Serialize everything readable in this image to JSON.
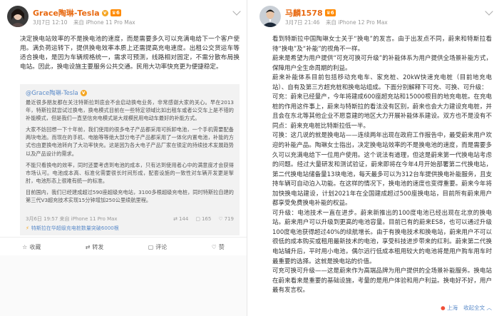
{
  "left": {
    "username": "Grace陶琳-Tesla",
    "level": "6",
    "date": "3月7日 12:10",
    "source": "来自 iPhone 11 Pro Max",
    "paragraphs": [
      "决定换电站效率的不是换电池的速度，而是需要多久可以充满电给下一个客户使用。满负荷运转下，提供换电效率本质上还需提高充电速度。出租公交货运车等适合换电，是因为车辆规格统一，需求可预测，线路相对固定，不需分散布局换电站。因此，换电设施主要服务公共交通。民用大功率快充更为便捷稳定。"
    ],
    "quote": {
      "author": "@Grace陶琳-Tesla",
      "paragraphs": [
        "最近很多朋友都在关注特斯拉到底会不会启动换电业务，非常感谢大家的关心。早在2013年，特斯拉就尝试过换电，换电模式目前在一些特定领域比如出租车或者公交车上是不错的补能模式，但是我们一直坚信充电模式是大规模民用电动车最好的补能方式。",
        "大家不妨回想一下十年前，我们使用的很多电子产品都采用可拆卸电池，一个手机需要配备两块电池。而现在的手机、电脑等等绝大部分电子产品都采用了一体化内置电池，补能的方式也由更换电池转向了大功率快充。这是因为各大电子产品厂家在锁定的持续技术发展趋势以及产品设计的需求。",
        "不能只看换电的效率，同时还要考虑到电池的成本，只有达到使用者心中的满意度才会获得市场认可。电池成本高、标准化需要很长时间形成，配套设施的一致性对车辆开发更是掣肘，电池形态上很难有统一的标准。",
        "目前国内，我们已经建成超过590座超级充电站，3100多根超级充电桩，同时特斯拉自建的第三代V3超充技术实现15分钟增加250公里续航里程。"
      ],
      "date": "3月6日 19:57",
      "source": "来自 iPhone 11 Pro Max",
      "reposts": "144",
      "comments": "165",
      "likes": "719",
      "link": "特斯拉在华超级充电桩数量突破6000根"
    },
    "actions": [
      "收藏",
      "转发",
      "评论",
      "赞"
    ]
  },
  "right": {
    "username": "马麟1578",
    "level": "6",
    "date": "3月7日 21:46",
    "source": "来自 iPhone 12 Pro Max",
    "paragraphs": [
      "看到特斯拉中国陶琳女士关于“换电”的发言。由于出发点不同，蔚来和特斯拉看待“换电”及“补能”的视角不一样。",
      "蔚来是希望为用户提供“可充可换可升级”的补能体系为用户提供全场景补能方式，保障用户全生命周期的利益。",
      "蔚来补能体系目前包括移动充电车、家充桩、20kW快速充电桩（目前地充电站）、自有及第三方超充桩和换电站组成。下面分别解释下可充、可换、可升级：",
      "可充：蔚来已经量产，今年将建成600座超充站和15000根目的地充电桩。在充电桩的作用这件事上，蔚来与特斯拉的看法没有区别，蔚来也会大力建设充电桩，并且会在东北等其他企业不愿意建的地区大力开展补能体系建设。双方也不是没有不同点：蔚来充电桩比特斯拉低一半。",
      "可换：这几说的就是换电站——连续两年出现在政府工作报告中，最受蔚来用户欢迎的补能产品。陶琳女士指出，决定换电站效率的不是换电池的速度，而是需要多久可以充满电给下一位用户使用。这个说法有道理，但这是蔚来第一代换电站考虑的问题。经过大量研发和测试验证，蔚来即将在今年4月开始部署第二代换电站，第二代换电站储备量13块电池，每天最多可以为312台车提供换电补能服务，且支持车辆可自动泊入功能。在这样的情况下，换电池的速度也变得重要。蔚来今年将加快换电站建设，计划2021年在全国建成超过500座换电站，目前所有蔚来用户都享受免费换电补能的权益。",
      "可升级：电池技术一直在进步。蔚来新推出的100度电池已经出现在北京的换电站。蔚来用户可以升级到更高的电池容量。目前已有的蔚来ES8，也可以通过升级100度电池获得超过40%的续航增长。由于有换电技术和换电站，蔚来用户不可以很低的成本购买或租用最新技术的电池，享受科技进步带来的红利。蔚来第二代换电站辅升后，平时用小电池，偶尔远行低成本租用较大的电池将是用户购车用车时最重要的选择。这就是换电站的价值。",
      "可充可换可升级——这是蔚来作为高端品牌为用户提供的全场景补能服务。换电站在蔚来看来是重要的基础设施，考量的是用户体验和用户利益。换电好不好，用户最有发言权。"
    ],
    "location": "上海",
    "collapse": "收起全文"
  }
}
